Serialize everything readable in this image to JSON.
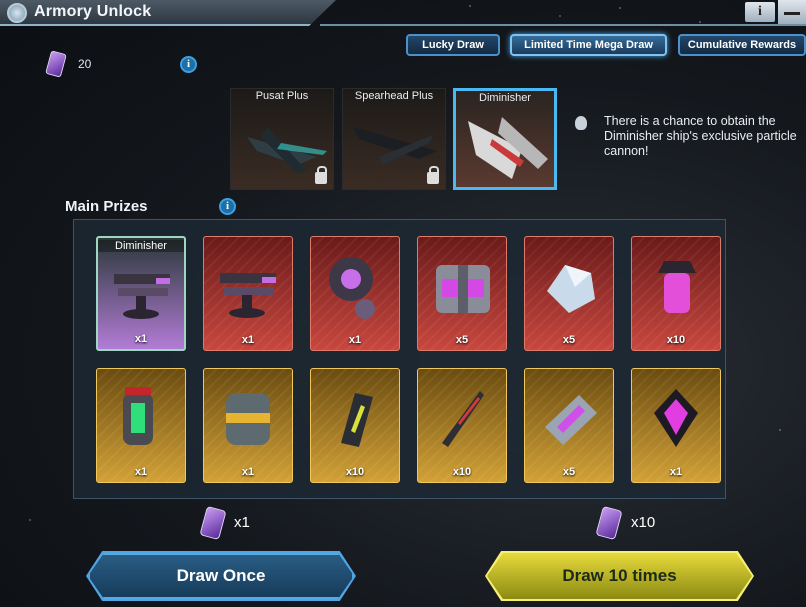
{
  "header": {
    "title": "Armory Unlock",
    "info_label": "i"
  },
  "tabs": [
    {
      "label": "Lucky Draw",
      "active": false
    },
    {
      "label": "Limited Time Mega Draw",
      "active": true
    },
    {
      "label": "Cumulative Rewards",
      "active": false
    }
  ],
  "currency": {
    "count": "20",
    "icon": "draw-ticket-icon"
  },
  "ships": [
    {
      "label": "Pusat Plus",
      "locked": true,
      "selected": false
    },
    {
      "label": "Spearhead Plus",
      "locked": true,
      "selected": false
    },
    {
      "label": "Diminisher",
      "locked": false,
      "selected": true
    }
  ],
  "hint": "There is a chance to obtain the Diminisher ship's exclusive particle cannon!",
  "main_prizes": {
    "title": "Main Prizes",
    "row1": [
      {
        "label": "Diminisher",
        "qty": "x1",
        "rarity": "purple",
        "icon": "particle-cannon-icon"
      },
      {
        "label": "",
        "qty": "x1",
        "rarity": "red",
        "icon": "particle-cannon-icon"
      },
      {
        "label": "",
        "qty": "x1",
        "rarity": "red",
        "icon": "core-module-icon"
      },
      {
        "label": "",
        "qty": "x5",
        "rarity": "red",
        "icon": "crate-icon"
      },
      {
        "label": "",
        "qty": "x5",
        "rarity": "red",
        "icon": "crystal-ore-icon"
      },
      {
        "label": "",
        "qty": "x10",
        "rarity": "red",
        "icon": "energy-cell-icon"
      }
    ],
    "row2": [
      {
        "label": "",
        "qty": "x1",
        "rarity": "gold",
        "icon": "fuel-canister-icon"
      },
      {
        "label": "",
        "qty": "x1",
        "rarity": "gold",
        "icon": "barrel-icon"
      },
      {
        "label": "",
        "qty": "x10",
        "rarity": "gold",
        "icon": "blueprint-card-icon"
      },
      {
        "label": "",
        "qty": "x10",
        "rarity": "gold",
        "icon": "rifle-part-icon"
      },
      {
        "label": "",
        "qty": "x5",
        "rarity": "gold",
        "icon": "battery-pack-icon"
      },
      {
        "label": "",
        "qty": "x1",
        "rarity": "gold",
        "icon": "dark-crystal-icon"
      }
    ]
  },
  "costs": {
    "once": "x1",
    "ten": "x10"
  },
  "buttons": {
    "draw_once": "Draw Once",
    "draw_ten": "Draw 10 times"
  }
}
